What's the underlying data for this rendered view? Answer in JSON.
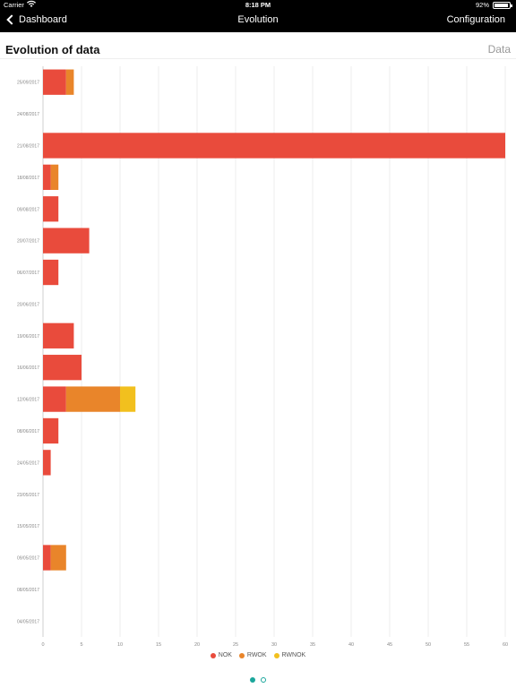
{
  "status": {
    "carrier": "Carrier",
    "time": "8:18 PM",
    "battery": "92%",
    "battery_level": 0.92
  },
  "nav": {
    "back_label": "Dashboard",
    "title": "Evolution",
    "config_label": "Configuration"
  },
  "header": {
    "title": "Evolution of data",
    "right_label": "Data"
  },
  "colors": {
    "NOK": "#e94b3c",
    "RWOK": "#e9852a",
    "RWNOK": "#f2c01e"
  },
  "chart_data": {
    "type": "bar",
    "orientation": "horizontal",
    "stacked": true,
    "categories": [
      "25/09/2017",
      "24/08/2017",
      "21/08/2017",
      "18/08/2017",
      "09/08/2017",
      "20/07/2017",
      "06/07/2017",
      "20/06/2017",
      "19/06/2017",
      "16/06/2017",
      "12/06/2017",
      "08/06/2017",
      "24/05/2017",
      "23/05/2017",
      "15/05/2017",
      "09/05/2017",
      "08/05/2017",
      "04/05/2017"
    ],
    "series": [
      {
        "name": "NOK",
        "values": [
          3,
          0,
          60,
          1,
          2,
          6,
          2,
          0,
          4,
          5,
          3,
          2,
          1,
          0,
          0,
          1,
          0,
          0
        ]
      },
      {
        "name": "RWOK",
        "values": [
          1,
          0,
          0,
          1,
          0,
          0,
          0,
          0,
          0,
          0,
          7,
          0,
          0,
          0,
          0,
          2,
          0,
          0
        ]
      },
      {
        "name": "RWNOK",
        "values": [
          0,
          0,
          0,
          0,
          0,
          0,
          0,
          0,
          0,
          0,
          2,
          0,
          0,
          0,
          0,
          0,
          0,
          0
        ]
      }
    ],
    "xlim": [
      0,
      60
    ],
    "x_ticks": [
      0,
      5,
      10,
      15,
      20,
      25,
      30,
      35,
      40,
      45,
      50,
      55,
      60
    ],
    "grid": true,
    "legend": "bottom-center"
  },
  "pager": {
    "pages": 2,
    "current": 1
  }
}
